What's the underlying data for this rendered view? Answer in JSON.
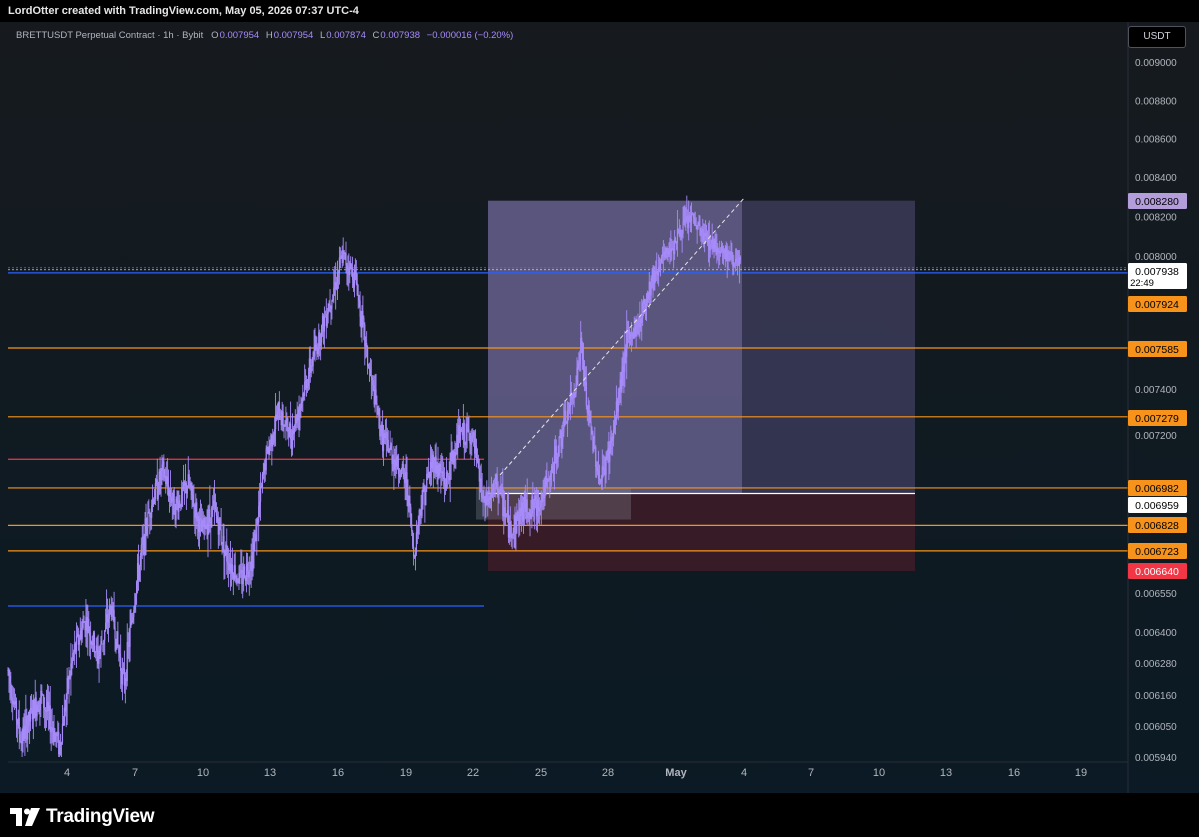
{
  "header": {
    "credit": "LordOtter created with TradingView.com, May 05, 2026 07:37 UTC-4"
  },
  "legend": {
    "symbol": "BRETTUSDT Perpetual Contract · 1h · Bybit",
    "o_label": "O",
    "o": "0.007954",
    "h_label": "H",
    "h": "0.007954",
    "l_label": "L",
    "l": "0.007874",
    "c_label": "C",
    "c": "0.007938",
    "change": "−0.000016 (−0.20%)"
  },
  "currency": "USDT",
  "brand": {
    "name": "TradingView"
  },
  "colors": {
    "candle": "#a78bfa",
    "orange": "#f7931a",
    "red": "#f23645",
    "blue": "#2962ff",
    "target_zone": "#7e6fb4",
    "stop_zone": "#5a1f2c"
  },
  "chart_data": {
    "type": "candlestick",
    "title": "",
    "x_ticks": [
      "4",
      "7",
      "10",
      "13",
      "16",
      "19",
      "22",
      "25",
      "28",
      "May",
      "4",
      "7",
      "10",
      "13",
      "16",
      "19"
    ],
    "y_ticks": [
      "0.009000",
      "0.008800",
      "0.008600",
      "0.008400",
      "0.008200",
      "0.008000",
      "0.007400",
      "0.007200",
      "0.006550",
      "0.006400",
      "0.006280",
      "0.006160",
      "0.006050",
      "0.005940"
    ],
    "price_labels": [
      {
        "text": "0.008280",
        "kind": "target"
      },
      {
        "text": "0.007938",
        "kind": "last",
        "sub": "22:49"
      },
      {
        "text": "0.007924",
        "kind": "level"
      },
      {
        "text": "0.007585",
        "kind": "level"
      },
      {
        "text": "0.007279",
        "kind": "level"
      },
      {
        "text": "0.006982",
        "kind": "level"
      },
      {
        "text": "0.006959",
        "kind": "entry"
      },
      {
        "text": "0.006828",
        "kind": "level"
      },
      {
        "text": "0.006723",
        "kind": "level"
      },
      {
        "text": "0.006640",
        "kind": "stop"
      }
    ],
    "horizontal_levels": [
      {
        "price": 0.007924,
        "color": "blue",
        "style": "solid",
        "extent": "full"
      },
      {
        "price": 0.007585,
        "color": "orange",
        "style": "solid",
        "extent": "full"
      },
      {
        "price": 0.007279,
        "color": "orange",
        "style": "solid",
        "extent": "full"
      },
      {
        "price": 0.0071,
        "color": "red",
        "style": "solid",
        "extent": "to-date-22"
      },
      {
        "price": 0.006982,
        "color": "orange",
        "style": "solid",
        "extent": "full"
      },
      {
        "price": 0.006828,
        "color": "orange",
        "style": "solid",
        "extent": "full"
      },
      {
        "price": 0.006723,
        "color": "orange",
        "style": "solid",
        "extent": "full"
      },
      {
        "price": 0.0065,
        "color": "blue",
        "style": "solid",
        "extent": "to-date-22"
      }
    ],
    "long_position": {
      "entry": 0.006959,
      "target": 0.00828,
      "stop": 0.00664
    },
    "price_path": [
      [
        0,
        0.00625
      ],
      [
        2,
        0.006
      ],
      [
        5,
        0.00616
      ],
      [
        8,
        0.00598
      ],
      [
        10,
        0.0063
      ],
      [
        12,
        0.00645
      ],
      [
        14,
        0.0063
      ],
      [
        16,
        0.0065
      ],
      [
        18,
        0.0062
      ],
      [
        20,
        0.0066
      ],
      [
        22,
        0.0069
      ],
      [
        24,
        0.00705
      ],
      [
        26,
        0.0069
      ],
      [
        28,
        0.007
      ],
      [
        30,
        0.0068
      ],
      [
        32,
        0.0069
      ],
      [
        34,
        0.0067
      ],
      [
        36,
        0.0066
      ],
      [
        38,
        0.0067
      ],
      [
        40,
        0.0071
      ],
      [
        42,
        0.0073
      ],
      [
        44,
        0.0072
      ],
      [
        46,
        0.0074
      ],
      [
        48,
        0.0076
      ],
      [
        50,
        0.0078
      ],
      [
        52,
        0.008
      ],
      [
        54,
        0.0079
      ],
      [
        56,
        0.0075
      ],
      [
        58,
        0.0072
      ],
      [
        60,
        0.0071
      ],
      [
        62,
        0.007
      ],
      [
        63,
        0.0067
      ],
      [
        64,
        0.0069
      ],
      [
        66,
        0.0071
      ],
      [
        68,
        0.007
      ],
      [
        70,
        0.0072
      ],
      [
        72,
        0.0072
      ],
      [
        74,
        0.0069
      ],
      [
        76,
        0.007
      ],
      [
        78,
        0.0068
      ],
      [
        80,
        0.0069
      ],
      [
        82,
        0.0069
      ],
      [
        84,
        0.007
      ],
      [
        86,
        0.0072
      ],
      [
        88,
        0.0074
      ],
      [
        89,
        0.0076
      ],
      [
        90,
        0.0073
      ],
      [
        92,
        0.007
      ],
      [
        94,
        0.0072
      ],
      [
        96,
        0.0076
      ],
      [
        98,
        0.0077
      ],
      [
        100,
        0.0079
      ],
      [
        102,
        0.008
      ],
      [
        104,
        0.0081
      ],
      [
        106,
        0.0082
      ],
      [
        108,
        0.0081
      ],
      [
        110,
        0.00805
      ],
      [
        112,
        0.008
      ],
      [
        114,
        0.00794
      ]
    ]
  }
}
